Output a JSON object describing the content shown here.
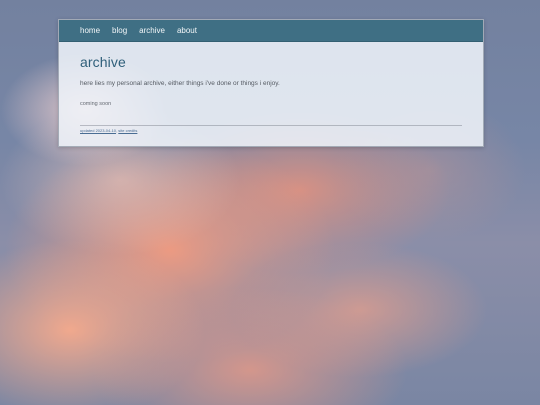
{
  "nav": {
    "items": [
      {
        "label": "home"
      },
      {
        "label": "blog"
      },
      {
        "label": "archive"
      },
      {
        "label": "about"
      }
    ]
  },
  "main": {
    "title": "archive",
    "intro": "here lies my personal archive, either things i've done or things i enjoy.",
    "status": "coming soon"
  },
  "footer": {
    "updated": "updated 2023-04-10",
    "separator": ",",
    "credits": "site credits"
  },
  "colors": {
    "nav_background": "#3f6f84",
    "title": "#2f5f7a"
  }
}
